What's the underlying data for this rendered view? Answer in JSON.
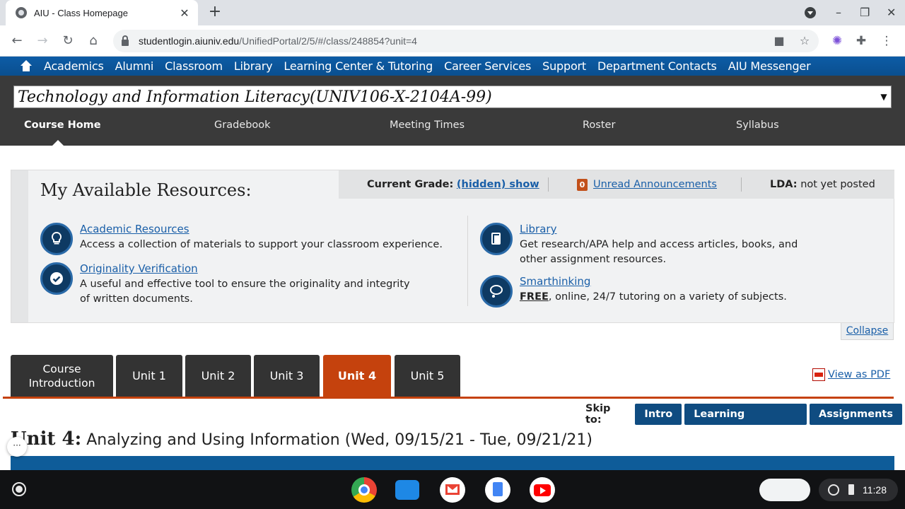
{
  "browser": {
    "tab_title": "AIU - Class Homepage",
    "url_host": "studentlogin.aiuniv.edu",
    "url_path": "/UnifiedPortal/2/5/#/class/248854?unit=4"
  },
  "site_nav": [
    "Academics",
    "Alumni",
    "Classroom",
    "Library",
    "Learning Center & Tutoring",
    "Career Services",
    "Support",
    "Department Contacts",
    "AIU Messenger"
  ],
  "course": {
    "title": "Technology and Information Literacy(UNIV106-X-2104A-99)",
    "tabs": [
      "Course Home",
      "Gradebook",
      "Meeting Times",
      "Roster",
      "Syllabus"
    ]
  },
  "resources": {
    "title": "My Available Resources:",
    "grade_label": "Current Grade:",
    "grade_value": "(hidden) show",
    "announcements_count": "0",
    "announcements_label": "Unread Announcements",
    "lda_label": "LDA:",
    "lda_value": "not yet posted",
    "items": [
      {
        "name": "Academic Resources",
        "desc": "Access a collection of materials to support your classroom experience."
      },
      {
        "name": "Originality Verification",
        "desc": "A useful and effective tool to ensure the originality and integrity of written documents."
      },
      {
        "name": "Library",
        "desc": "Get research/APA help and access articles, books, and other assignment resources."
      },
      {
        "name": "Smarthinking",
        "desc_strong": "FREE",
        "desc": ", online, 24/7 tutoring on a variety of subjects."
      }
    ],
    "collapse": "Collapse"
  },
  "units": {
    "tabs": [
      "Course Introduction",
      "Unit 1",
      "Unit 2",
      "Unit 3",
      "Unit 4",
      "Unit 5"
    ],
    "active_index": 4,
    "view_pdf": "View as PDF",
    "skip_label": "Skip to:",
    "skip_buttons": [
      "Intro",
      "Learning Activities",
      "Assignments"
    ],
    "heading_label": "Unit 4:",
    "heading_text": "Analyzing and Using Information (Wed, 09/15/21 - Tue, 09/21/21)"
  },
  "shelf": {
    "time": "11:28"
  },
  "colors": {
    "nav_blue": "#0d5ca6",
    "course_bar": "#3a3a3a",
    "active_unit": "#c5420d",
    "link": "#1a5fa8"
  }
}
